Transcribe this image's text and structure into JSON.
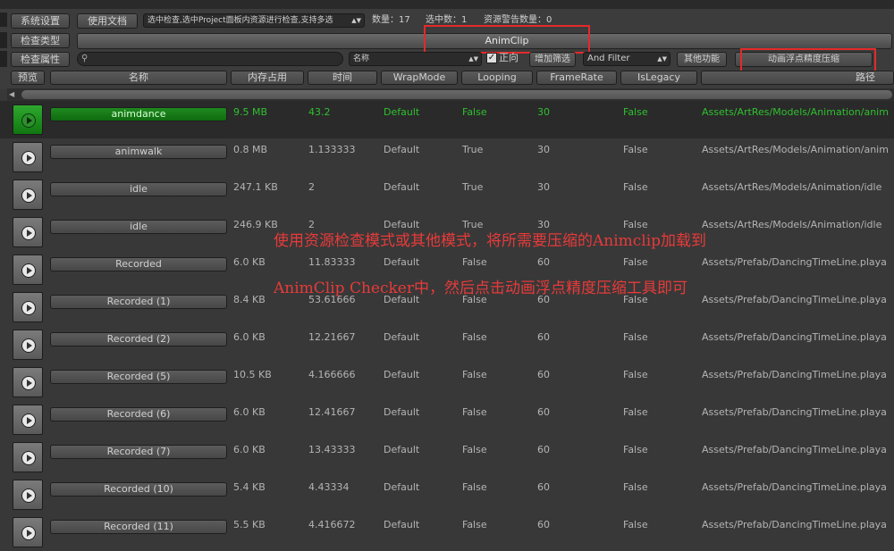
{
  "toolbar": {
    "system_settings": "系统设置",
    "docs": "使用文档",
    "selection_check": "选中检查,选中Project面板内资源进行检查,支持多选",
    "count_text": "数量：17",
    "selected_text": "选中数：1",
    "warn_text": "资源警告数量：0",
    "check_type_label": "检查类型",
    "check_type_value": "AnimClip",
    "check_attr_label": "检查属性",
    "search_value": "",
    "attr_dropdown": "名称",
    "positive_label": "正向",
    "positive_checked": true,
    "add_filter": "增加筛选",
    "filter_mode": "And Filter",
    "other_func": "其他功能",
    "compress_tool": "动画浮点精度压缩"
  },
  "columns": [
    "预览",
    "名称",
    "内存占用",
    "时间",
    "WrapMode",
    "Looping",
    "FrameRate",
    "IsLegacy",
    "路径"
  ],
  "rows": [
    {
      "name": "animdance",
      "memory": "9.5 MB",
      "time": "43.2",
      "wrap": "Default",
      "looping": "False",
      "framerate": "30",
      "legacy": "False",
      "path": "Assets/ArtRes/Models/Animation/anim",
      "selected": true
    },
    {
      "name": "animwalk",
      "memory": "0.8 MB",
      "time": "1.133333",
      "wrap": "Default",
      "looping": "True",
      "framerate": "30",
      "legacy": "False",
      "path": "Assets/ArtRes/Models/Animation/anim"
    },
    {
      "name": "idle",
      "memory": "247.1 KB",
      "time": "2",
      "wrap": "Default",
      "looping": "True",
      "framerate": "30",
      "legacy": "False",
      "path": "Assets/ArtRes/Models/Animation/idle"
    },
    {
      "name": "idle",
      "memory": "246.9 KB",
      "time": "2",
      "wrap": "Default",
      "looping": "True",
      "framerate": "30",
      "legacy": "False",
      "path": "Assets/ArtRes/Models/Animation/idle"
    },
    {
      "name": "Recorded",
      "memory": "6.0 KB",
      "time": "11.83333",
      "wrap": "Default",
      "looping": "False",
      "framerate": "60",
      "legacy": "False",
      "path": "Assets/Prefab/DancingTimeLine.playa"
    },
    {
      "name": "Recorded (1)",
      "memory": "8.4 KB",
      "time": "53.61666",
      "wrap": "Default",
      "looping": "False",
      "framerate": "60",
      "legacy": "False",
      "path": "Assets/Prefab/DancingTimeLine.playa"
    },
    {
      "name": "Recorded (2)",
      "memory": "6.0 KB",
      "time": "12.21667",
      "wrap": "Default",
      "looping": "False",
      "framerate": "60",
      "legacy": "False",
      "path": "Assets/Prefab/DancingTimeLine.playa"
    },
    {
      "name": "Recorded (5)",
      "memory": "10.5 KB",
      "time": "4.166666",
      "wrap": "Default",
      "looping": "False",
      "framerate": "60",
      "legacy": "False",
      "path": "Assets/Prefab/DancingTimeLine.playa"
    },
    {
      "name": "Recorded (6)",
      "memory": "6.0 KB",
      "time": "12.41667",
      "wrap": "Default",
      "looping": "False",
      "framerate": "60",
      "legacy": "False",
      "path": "Assets/Prefab/DancingTimeLine.playa"
    },
    {
      "name": "Recorded (7)",
      "memory": "6.0 KB",
      "time": "13.43333",
      "wrap": "Default",
      "looping": "False",
      "framerate": "60",
      "legacy": "False",
      "path": "Assets/Prefab/DancingTimeLine.playa"
    },
    {
      "name": "Recorded (10)",
      "memory": "5.4 KB",
      "time": "4.43334",
      "wrap": "Default",
      "looping": "False",
      "framerate": "60",
      "legacy": "False",
      "path": "Assets/Prefab/DancingTimeLine.playa"
    },
    {
      "name": "Recorded (11)",
      "memory": "5.5 KB",
      "time": "4.416672",
      "wrap": "Default",
      "looping": "False",
      "framerate": "60",
      "legacy": "False",
      "path": "Assets/Prefab/DancingTimeLine.playa"
    }
  ],
  "annotations": [
    "使用资源检查模式或其他模式，将所需要压缩的Animclip加载到",
    "AnimClip Checker中，然后点击动画浮点精度压缩工具即可"
  ],
  "colors": {
    "highlight": "#e32a2a",
    "selected_green": "#2fc02f"
  }
}
